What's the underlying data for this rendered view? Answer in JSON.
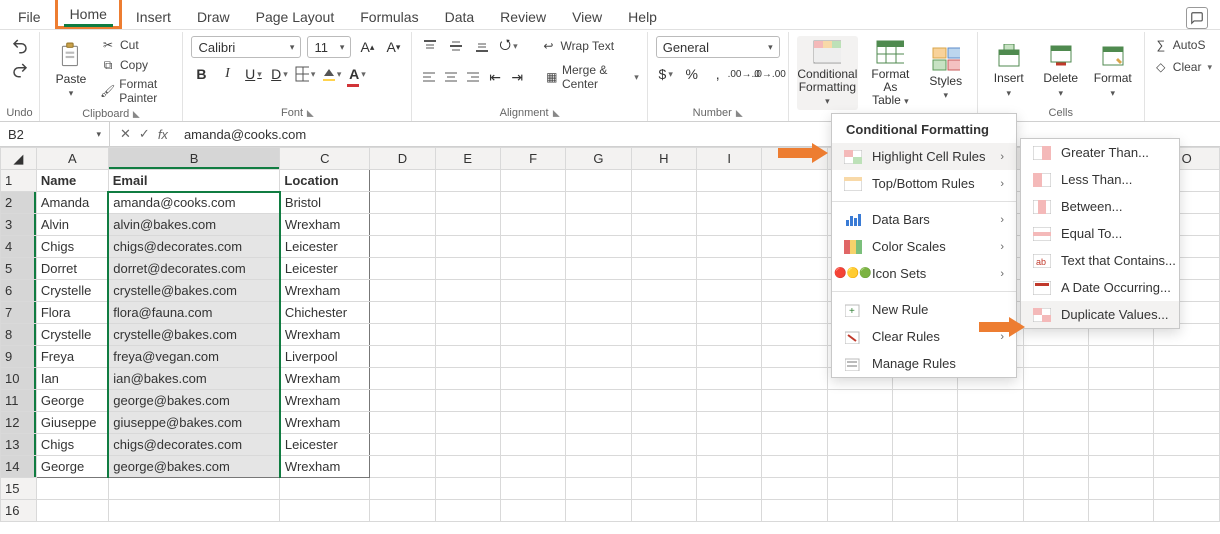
{
  "tabs": {
    "file": "File",
    "home": "Home",
    "insert": "Insert",
    "draw": "Draw",
    "page_layout": "Page Layout",
    "formulas": "Formulas",
    "data": "Data",
    "review": "Review",
    "view": "View",
    "help": "Help"
  },
  "ribbon": {
    "undo_label": "Undo",
    "clipboard": {
      "paste": "Paste",
      "cut": "Cut",
      "copy": "Copy",
      "format_painter": "Format Painter",
      "group": "Clipboard"
    },
    "font": {
      "name": "Calibri",
      "size": "11",
      "group": "Font"
    },
    "alignment": {
      "wrap": "Wrap Text",
      "merge": "Merge & Center",
      "group": "Alignment"
    },
    "number": {
      "format": "General",
      "group": "Number"
    },
    "styles": {
      "cond": "Conditional",
      "cond2": "Formatting",
      "fat": "Format As",
      "fat2": "Table",
      "styles": "Styles"
    },
    "cells": {
      "insert": "Insert",
      "delete": "Delete",
      "format": "Format",
      "group": "Cells"
    },
    "editing": {
      "autosum": "AutoS",
      "clear": "Clear"
    }
  },
  "formula_bar": {
    "name_box": "B2",
    "formula": "amanda@cooks.com",
    "fx": "fx"
  },
  "columns": [
    "A",
    "B",
    "C",
    "D",
    "E",
    "F",
    "G",
    "H",
    "I",
    "",
    "",
    "",
    "",
    "",
    "",
    "O"
  ],
  "headers": {
    "name": "Name",
    "email": "Email",
    "location": "Location"
  },
  "rows": [
    {
      "n": "Amanda",
      "e": "amanda@cooks.com",
      "l": "Bristol"
    },
    {
      "n": "Alvin",
      "e": "alvin@bakes.com",
      "l": "Wrexham"
    },
    {
      "n": "Chigs",
      "e": "chigs@decorates.com",
      "l": "Leicester"
    },
    {
      "n": "Dorret",
      "e": "dorret@decorates.com",
      "l": "Leicester"
    },
    {
      "n": "Crystelle",
      "e": "crystelle@bakes.com",
      "l": "Wrexham"
    },
    {
      "n": "Flora",
      "e": "flora@fauna.com",
      "l": "Chichester"
    },
    {
      "n": "Crystelle",
      "e": "crystelle@bakes.com",
      "l": "Wrexham"
    },
    {
      "n": "Freya",
      "e": "freya@vegan.com",
      "l": "Liverpool"
    },
    {
      "n": "Ian",
      "e": "ian@bakes.com",
      "l": "Wrexham"
    },
    {
      "n": "George",
      "e": "george@bakes.com",
      "l": "Wrexham"
    },
    {
      "n": "Giuseppe",
      "e": "giuseppe@bakes.com",
      "l": "Wrexham"
    },
    {
      "n": "Chigs",
      "e": "chigs@decorates.com",
      "l": "Leicester"
    },
    {
      "n": "George",
      "e": "george@bakes.com",
      "l": "Wrexham"
    }
  ],
  "cf_menu": {
    "title": "Conditional Formatting",
    "highlight": "Highlight Cell Rules",
    "topbottom": "Top/Bottom Rules",
    "databars": "Data Bars",
    "colorscales": "Color Scales",
    "iconsets": "Icon Sets",
    "newrule": "New Rule",
    "clear": "Clear Rules",
    "manage": "Manage Rules"
  },
  "hcr_menu": {
    "gt": "Greater Than...",
    "lt": "Less Than...",
    "between": "Between...",
    "eq": "Equal To...",
    "text": "Text that Contains...",
    "date": "A Date Occurring...",
    "dup": "Duplicate Values..."
  }
}
